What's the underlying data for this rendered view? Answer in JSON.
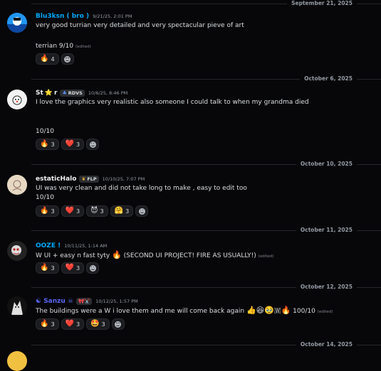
{
  "colors": {
    "bg": "#070709",
    "text": "#dbdee1",
    "muted": "#949ba4",
    "blue_name": "#00a8fc",
    "purple_name": "#5865f2"
  },
  "dividers": [
    "September 21, 2025",
    "October 6, 2025",
    "October 10, 2025",
    "October 11, 2025",
    "October 12, 2025",
    "October 14, 2025"
  ],
  "messages": [
    {
      "username": "Blu3ksn ( bro )",
      "timestamp": "9/21/25, 2:01 PM",
      "line1": "very good turrian very detailed and very spectacular pieve of art",
      "line2": "terrian 9/10",
      "edited": "(edited)",
      "reactions": [
        {
          "emoji": "🔥",
          "count": "4"
        }
      ]
    },
    {
      "username_prefix": "St",
      "username_star": "⭐",
      "username_suffix": "r",
      "tag": "RDVS",
      "timestamp": "10/6/25, 8:46 PM",
      "line1": "I love the graphics very realistic also someone I could talk to when my grandma died",
      "line2": "10/10",
      "reactions": [
        {
          "emoji": "🔥",
          "count": "3"
        },
        {
          "emoji": "❤️",
          "count": "3"
        }
      ]
    },
    {
      "username": "estaticHalo",
      "tag": "FLP",
      "timestamp": "10/10/25, 7:07 PM",
      "line1": "UI was very clean and did not take long to make , easy to edit too",
      "line2": "10/10",
      "reactions": [
        {
          "emoji": "🔥",
          "count": "3"
        },
        {
          "emoji": "❤️",
          "count": "3"
        },
        {
          "emoji": "😈",
          "count": "3"
        },
        {
          "emoji": "🤗",
          "count": "3"
        }
      ]
    },
    {
      "username": "OOZE !",
      "timestamp": "10/11/25, 1:14 AM",
      "line1_a": "W UI + easy n fast tyty ",
      "fire": "🔥",
      "line1_b": " (SECOND UI PROJECT! FIRE AS USUALLY!) ",
      "edited": "(edited)",
      "reactions": [
        {
          "emoji": "🔥",
          "count": "3"
        },
        {
          "emoji": "❤️",
          "count": "3"
        }
      ]
    },
    {
      "username": "☯ Sanzu ☠",
      "tag": "🎀✂️",
      "timestamp": "10/12/25, 1:57 PM",
      "line1_a": "The buildings were a W i love them and me will come back again ",
      "emojis": "👍😆🥹🇼🔥",
      "line1_b": " 100/10 ",
      "edited": "(edited)",
      "reactions": [
        {
          "emoji": "🔥",
          "count": "3"
        },
        {
          "emoji": "❤️",
          "count": "3"
        },
        {
          "emoji": "🤩",
          "count": "3"
        }
      ]
    }
  ],
  "icons": {
    "add_reaction": "add-reaction-icon"
  }
}
